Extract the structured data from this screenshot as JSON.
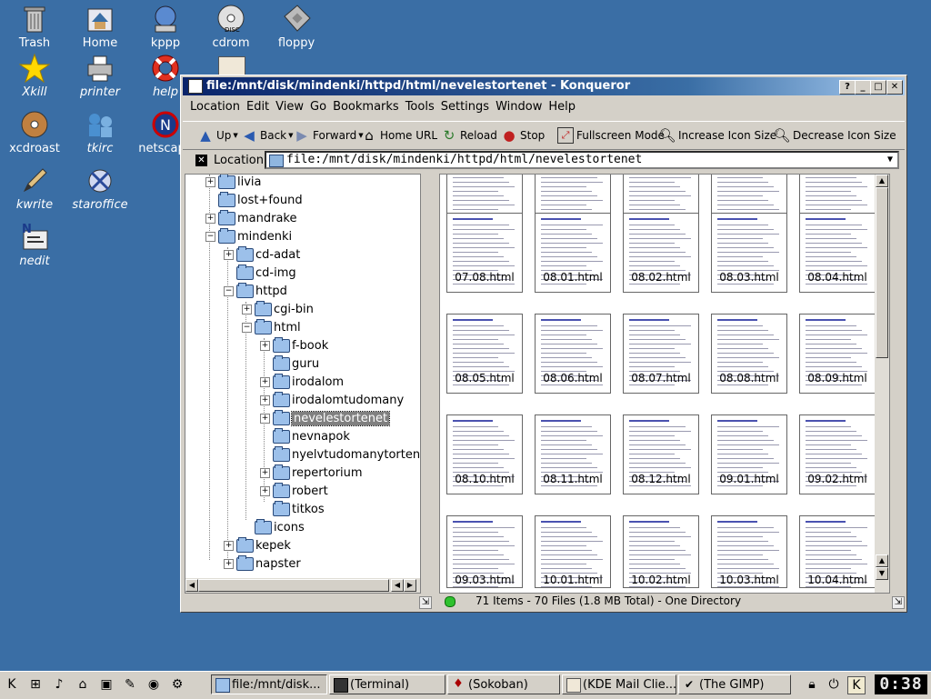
{
  "desktop_icons": [
    {
      "label": "Trash",
      "icon": "trash-icon",
      "italic": false
    },
    {
      "label": "Home",
      "icon": "home-icon",
      "italic": false
    },
    {
      "label": "kppp",
      "icon": "kppp-icon",
      "italic": false
    },
    {
      "label": "cdrom",
      "icon": "cdrom-icon",
      "italic": false
    },
    {
      "label": "floppy",
      "icon": "floppy-icon",
      "italic": false
    },
    {
      "label": "Xkill",
      "icon": "star-icon",
      "italic": true
    },
    {
      "label": "printer",
      "icon": "printer-icon",
      "italic": true
    },
    {
      "label": "help",
      "icon": "lifebuoy-icon",
      "italic": true
    },
    {
      "label": "xcdroast",
      "icon": "cd-burn-icon",
      "italic": false
    },
    {
      "label": "tkirc",
      "icon": "irc-icon",
      "italic": true
    },
    {
      "label": "netscape",
      "icon": "netscape-icon",
      "italic": false
    },
    {
      "label": "kwrite",
      "icon": "pen-icon",
      "italic": true
    },
    {
      "label": "staroffice",
      "icon": "staroffice-icon",
      "italic": true
    },
    {
      "label": "nedit",
      "icon": "nedit-icon",
      "italic": true
    }
  ],
  "window": {
    "title": "file:/mnt/disk/mindenki/httpd/html/nevelestortenet - Konqueror",
    "buttons": [
      "?",
      "_",
      "□",
      "✕"
    ]
  },
  "menu": [
    "Location",
    "Edit",
    "View",
    "Go",
    "Bookmarks",
    "Tools",
    "Settings",
    "Window",
    "Help"
  ],
  "toolbar": {
    "up": "Up",
    "back": "Back",
    "forward": "Forward",
    "home": "Home URL",
    "reload": "Reload",
    "stop": "Stop",
    "fullscreen": "Fullscreen Mode",
    "increase": "Increase Icon Size",
    "decrease": "Decrease Icon Size"
  },
  "location": {
    "label": "Location",
    "value": "file:/mnt/disk/mindenki/httpd/html/nevelestortenet"
  },
  "tree": [
    {
      "label": "livia",
      "level": 1,
      "expandable": true
    },
    {
      "label": "lost+found",
      "level": 1,
      "expandable": false
    },
    {
      "label": "mandrake",
      "level": 1,
      "expandable": true
    },
    {
      "label": "mindenki",
      "level": 1,
      "expandable": true,
      "open": true
    },
    {
      "label": "cd-adat",
      "level": 2,
      "expandable": true
    },
    {
      "label": "cd-img",
      "level": 2,
      "expandable": false
    },
    {
      "label": "httpd",
      "level": 2,
      "expandable": true,
      "open": true
    },
    {
      "label": "cgi-bin",
      "level": 3,
      "expandable": true
    },
    {
      "label": "html",
      "level": 3,
      "expandable": true,
      "open": true
    },
    {
      "label": "f-book",
      "level": 4,
      "expandable": true
    },
    {
      "label": "guru",
      "level": 4,
      "expandable": false
    },
    {
      "label": "irodalom",
      "level": 4,
      "expandable": true
    },
    {
      "label": "irodalomtudomany",
      "level": 4,
      "expandable": true
    },
    {
      "label": "nevelestortenet",
      "level": 4,
      "expandable": true,
      "selected": true
    },
    {
      "label": "nevnapok",
      "level": 4,
      "expandable": false
    },
    {
      "label": "nyelvtudomanytortenet",
      "level": 4,
      "expandable": false
    },
    {
      "label": "repertorium",
      "level": 4,
      "expandable": true
    },
    {
      "label": "robert",
      "level": 4,
      "expandable": true
    },
    {
      "label": "titkos",
      "level": 4,
      "expandable": false
    },
    {
      "label": "icons",
      "level": 3,
      "expandable": false
    },
    {
      "label": "kepek",
      "level": 2,
      "expandable": true
    },
    {
      "label": "napster",
      "level": 2,
      "expandable": true
    }
  ],
  "files": {
    "row0": [
      "07.08.html",
      "08.01.html",
      "08.02.html",
      "08.03.html",
      "08.04.html"
    ],
    "row1": [
      "08.05.html",
      "08.06.html",
      "08.07.html",
      "08.08.html",
      "08.09.html"
    ],
    "row2": [
      "08.10.html",
      "08.11.html",
      "08.12.html",
      "09.01.html",
      "09.02.html"
    ],
    "row3": [
      "09.03.html",
      "10.01.html",
      "10.02.html",
      "10.03.html",
      "10.04.html"
    ]
  },
  "status": "71 Items - 70 Files (1.8 MB Total) - One Directory",
  "taskbar": {
    "tasks": [
      {
        "label": "file:/mnt/disk...",
        "active": true
      },
      {
        "label": "(Terminal)",
        "active": false
      },
      {
        "label": "(Sokoban)",
        "active": false
      },
      {
        "label": "(KDE Mail Clie...",
        "active": false
      },
      {
        "label": "(The GIMP)",
        "active": false
      }
    ],
    "clock": "0:38"
  }
}
